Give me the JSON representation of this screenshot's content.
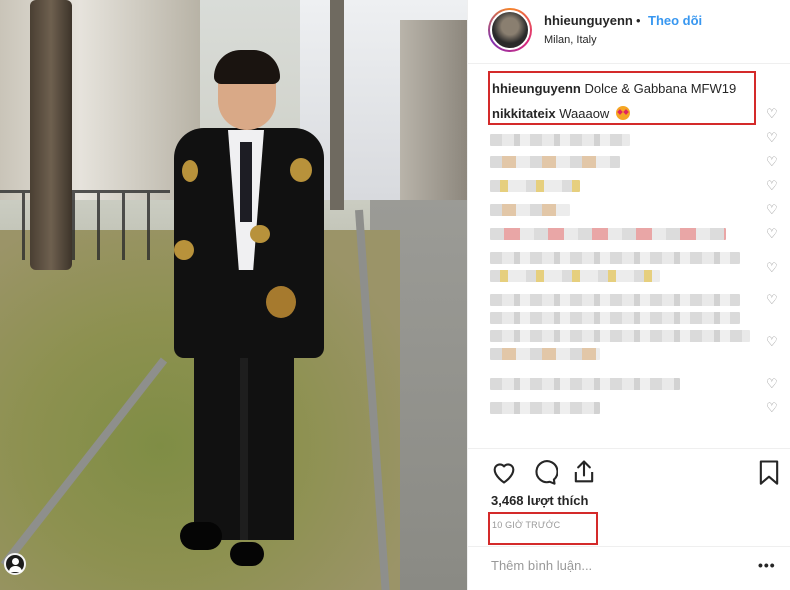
{
  "post": {
    "username": "hhieunguyenn",
    "separator": "•",
    "follow_label": "Theo dõi",
    "location": "Milan, Italy"
  },
  "caption": {
    "author": "hhieunguyenn",
    "text": "Dolce & Gabbana MFW19"
  },
  "comments": [
    {
      "author": "nikkitateix",
      "text": "Waaaow",
      "emoji": "heart-eyes-emoji"
    }
  ],
  "blurred_comment_count": 12,
  "actions": {
    "like_icon": "heart-icon",
    "comment_icon": "comment-icon",
    "share_icon": "share-icon",
    "save_icon": "bookmark-icon"
  },
  "likes_text": "3,468 lượt thích",
  "timestamp": "10 GIỜ TRƯỚC",
  "comment_placeholder": "Thêm bình luận...",
  "more_label": "•••",
  "colors": {
    "link_blue": "#3897f0",
    "highlight_red": "#d42a2a",
    "text": "#262626",
    "muted": "#999999"
  }
}
